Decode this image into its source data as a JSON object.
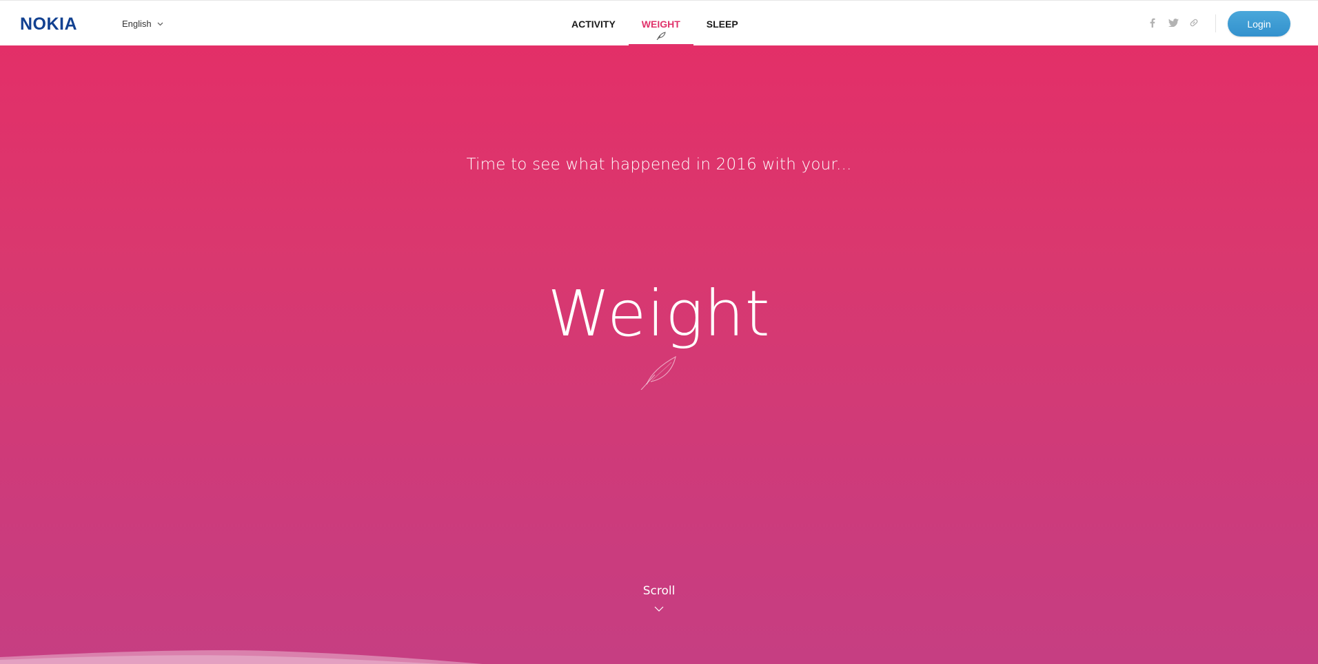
{
  "header": {
    "logo": "NOKIA",
    "language": "English",
    "nav": [
      {
        "label": "ACTIVITY",
        "active": false
      },
      {
        "label": "WEIGHT",
        "active": true
      },
      {
        "label": "SLEEP",
        "active": false
      }
    ],
    "social_icons": [
      "facebook-icon",
      "twitter-icon",
      "link-icon"
    ],
    "login_label": "Login"
  },
  "hero": {
    "intro": "Time to see what happened in 2016 with your...",
    "title": "Weight",
    "scroll_label": "Scroll"
  },
  "colors": {
    "brand_blue": "#124191",
    "accent_pink": "#e0336b",
    "login_blue": "#3a9bd3",
    "hero_top": "#e32f68",
    "hero_bottom": "#c63e82"
  }
}
